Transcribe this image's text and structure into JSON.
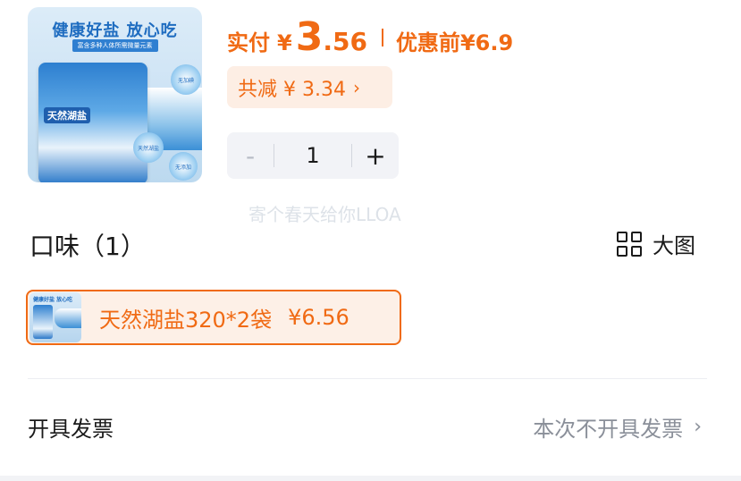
{
  "product": {
    "image": {
      "headline": "健康好盐 放心吃",
      "subline": "富含多种人体所需微量元素",
      "bag_label": "天然湖盐",
      "badge1": "无加碘",
      "badge2": "天然湖盐",
      "badge3": "无添加"
    }
  },
  "pricing": {
    "label_actual": "实付",
    "currency": "¥",
    "actual_int": "3",
    "actual_dec": ".56",
    "before_label": "优惠前",
    "before_price": "¥6.9",
    "discount_text": "共减 ¥ 3.34",
    "discount_chevron": "›"
  },
  "quantity": {
    "minus": "-",
    "value": "1",
    "plus": "+"
  },
  "watermark": "寄个春天给你LLOA",
  "flavor": {
    "title": "口味（1）",
    "bigview_label": "大图",
    "options": [
      {
        "thumb_text": "健康好盐 放心吃",
        "name": "天然湖盐320*2袋",
        "price": "¥6.56"
      }
    ]
  },
  "invoice": {
    "label": "开具发票",
    "value": "本次不开具发票",
    "chevron": "›"
  },
  "colors": {
    "accent": "#f06a14",
    "accent_bg": "#fdeee4",
    "muted_text": "#8a8f99",
    "stepper_bg": "#f2f3f7"
  }
}
